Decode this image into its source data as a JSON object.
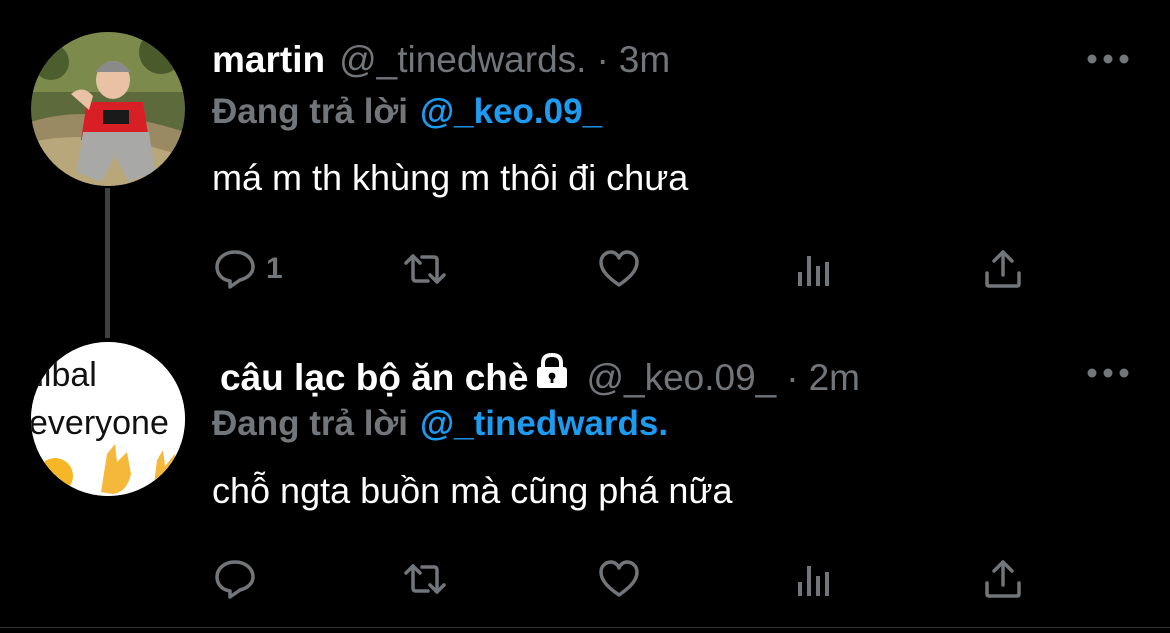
{
  "tweets": [
    {
      "display_name": "martin",
      "handle": "@_tinedwards.",
      "separator": "·",
      "time": "3m",
      "reply_prefix": "Đang trả lời",
      "reply_to": "@_keo.09_",
      "text": "má m th khùng m thôi đi chưa",
      "reply_count": "1",
      "locked": false
    },
    {
      "display_name": "câu lạc bộ ăn chè",
      "handle": "@_keo.09_",
      "separator": "·",
      "time": "2m",
      "reply_prefix": "Đang trả lời",
      "reply_to": "@_tinedwards.",
      "text": "chỗ ngta buồn mà cũng phá nữa",
      "reply_count": "",
      "locked": true,
      "avatar_text": [
        "nibal",
        "everyone"
      ]
    }
  ],
  "colors": {
    "background": "#000000",
    "primary_text": "#ffffff",
    "secondary_text": "#71767b",
    "link": "#1d9bf0",
    "thread_line": "#3e4144"
  },
  "icons": [
    "more-icon",
    "reply-icon",
    "retweet-icon",
    "like-icon",
    "views-icon",
    "share-icon",
    "lock-icon"
  ]
}
